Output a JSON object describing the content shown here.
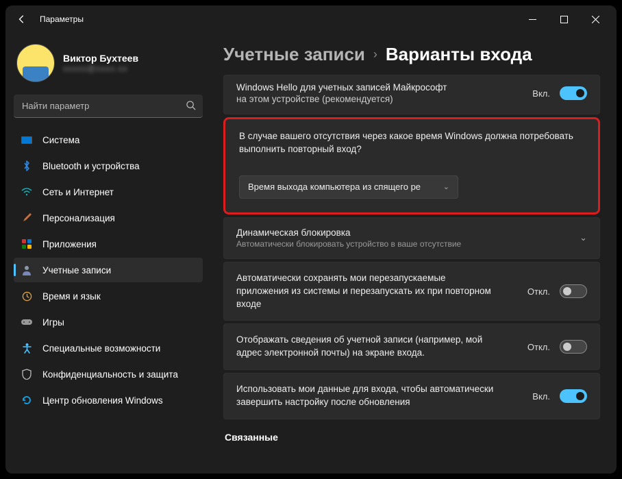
{
  "titlebar": {
    "title": "Параметры"
  },
  "user": {
    "name": "Виктор Бухтеев",
    "email": "xxxxx@xxxx.xx"
  },
  "search": {
    "placeholder": "Найти параметр"
  },
  "nav": {
    "system": "Система",
    "bluetooth": "Bluetooth и устройства",
    "network": "Сеть и Интернет",
    "personalization": "Персонализация",
    "apps": "Приложения",
    "accounts": "Учетные записи",
    "time": "Время и язык",
    "gaming": "Игры",
    "accessibility": "Специальные возможности",
    "privacy": "Конфиденциальность и защита",
    "update": "Центр обновления Windows"
  },
  "breadcrumb": {
    "parent": "Учетные записи",
    "current": "Варианты входа"
  },
  "hello": {
    "line1": "Windows Hello для учетных записей Майкрософт",
    "line2": "на этом устройстве (рекомендуется)",
    "state": "Вкл."
  },
  "reauth": {
    "question": "В случае вашего отсутствия через какое время Windows должна потребовать выполнить повторный вход?",
    "selected": "Время выхода компьютера из спящего ре"
  },
  "dynlock": {
    "title": "Динамическая блокировка",
    "sub": "Автоматически блокировать устройство в ваше отсутствие"
  },
  "restart_apps": {
    "text": "Автоматически сохранять мои перезапускаемые приложения из системы и перезапускать их при повторном входе",
    "state": "Откл."
  },
  "show_account": {
    "text": "Отображать сведения об учетной записи (например, мой адрес электронной почты) на экране входа.",
    "state": "Откл."
  },
  "use_data": {
    "text": "Использовать мои данные для входа, чтобы автоматически завершить настройку после обновления",
    "state": "Вкл."
  },
  "related": "Связанные"
}
